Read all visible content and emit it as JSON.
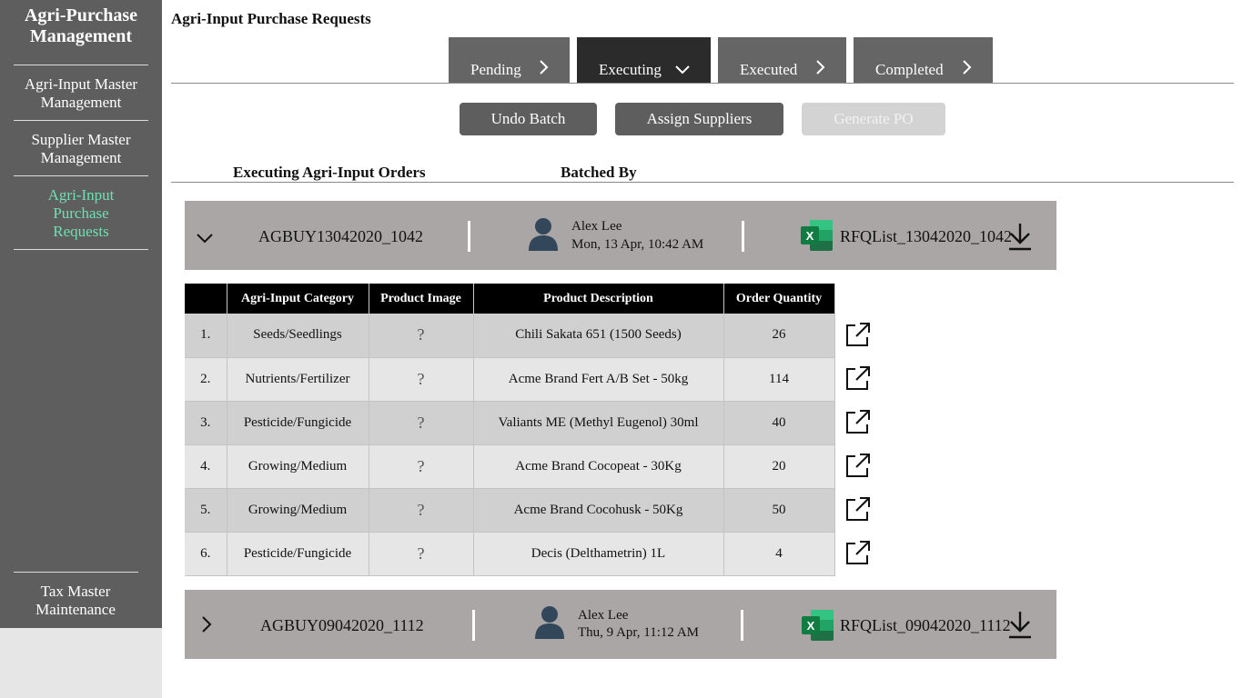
{
  "sidebar": {
    "brand": "Agri-Purchase Management",
    "items": [
      {
        "label": "Agri-Input Master Management"
      },
      {
        "label": "Supplier Master Management"
      },
      {
        "label": "Agri-Input Purchase Requests"
      }
    ],
    "footer_item": "Tax Master Maintenance",
    "active_color": "#6fe0b4"
  },
  "header": {
    "title": "Agri-Input Purchase Requests"
  },
  "tabs": [
    {
      "label": "Pending",
      "icon": "chevron-right-icon"
    },
    {
      "label": "Executing",
      "icon": "chevron-down-icon",
      "active": true
    },
    {
      "label": "Executed",
      "icon": "chevron-right-icon"
    },
    {
      "label": "Completed",
      "icon": "chevron-right-icon"
    }
  ],
  "actions": {
    "undo": "Undo Batch",
    "assign": "Assign Suppliers",
    "generate": "Generate PO"
  },
  "sections": {
    "orders_heading": "Executing Agri-Input Orders",
    "batched_by_heading": "Batched By"
  },
  "batches": [
    {
      "id": "AGBUY13042020_1042",
      "expanded": true,
      "user": "Alex Lee",
      "date": "Mon, 13 Apr, 10:42 AM",
      "file": "RFQList_13042020_1042"
    },
    {
      "id": "AGBUY09042020_1112",
      "expanded": false,
      "user": "Alex Lee",
      "date": "Thu, 9 Apr, 11:12 AM",
      "file": "RFQList_09042020_1112"
    }
  ],
  "table": {
    "headers": [
      "",
      "Agri-Input Category",
      "Product Image",
      "Product Description",
      "Order Quantity"
    ],
    "rows": [
      {
        "no": "1.",
        "category": "Seeds/Seedlings",
        "image": "?",
        "description": "Chili Sakata 651 (1500 Seeds)",
        "qty": "26"
      },
      {
        "no": "2.",
        "category": "Nutrients/Fertilizer",
        "image": "?",
        "description": "Acme Brand Fert A/B Set - 50kg",
        "qty": "114"
      },
      {
        "no": "3.",
        "category": "Pesticide/Fungicide",
        "image": "?",
        "description": "Valiants ME (Methyl Eugenol) 30ml",
        "qty": "40"
      },
      {
        "no": "4.",
        "category": "Growing/Medium",
        "image": "?",
        "description": "Acme Brand Cocopeat - 30Kg",
        "qty": "20"
      },
      {
        "no": "5.",
        "category": "Growing/Medium",
        "image": "?",
        "description": "Acme Brand Cocohusk - 50Kg",
        "qty": "50"
      },
      {
        "no": "6.",
        "category": "Pesticide/Fungicide",
        "image": "?",
        "description": "Decis (Delthametrin) 1L",
        "qty": "4"
      }
    ]
  }
}
